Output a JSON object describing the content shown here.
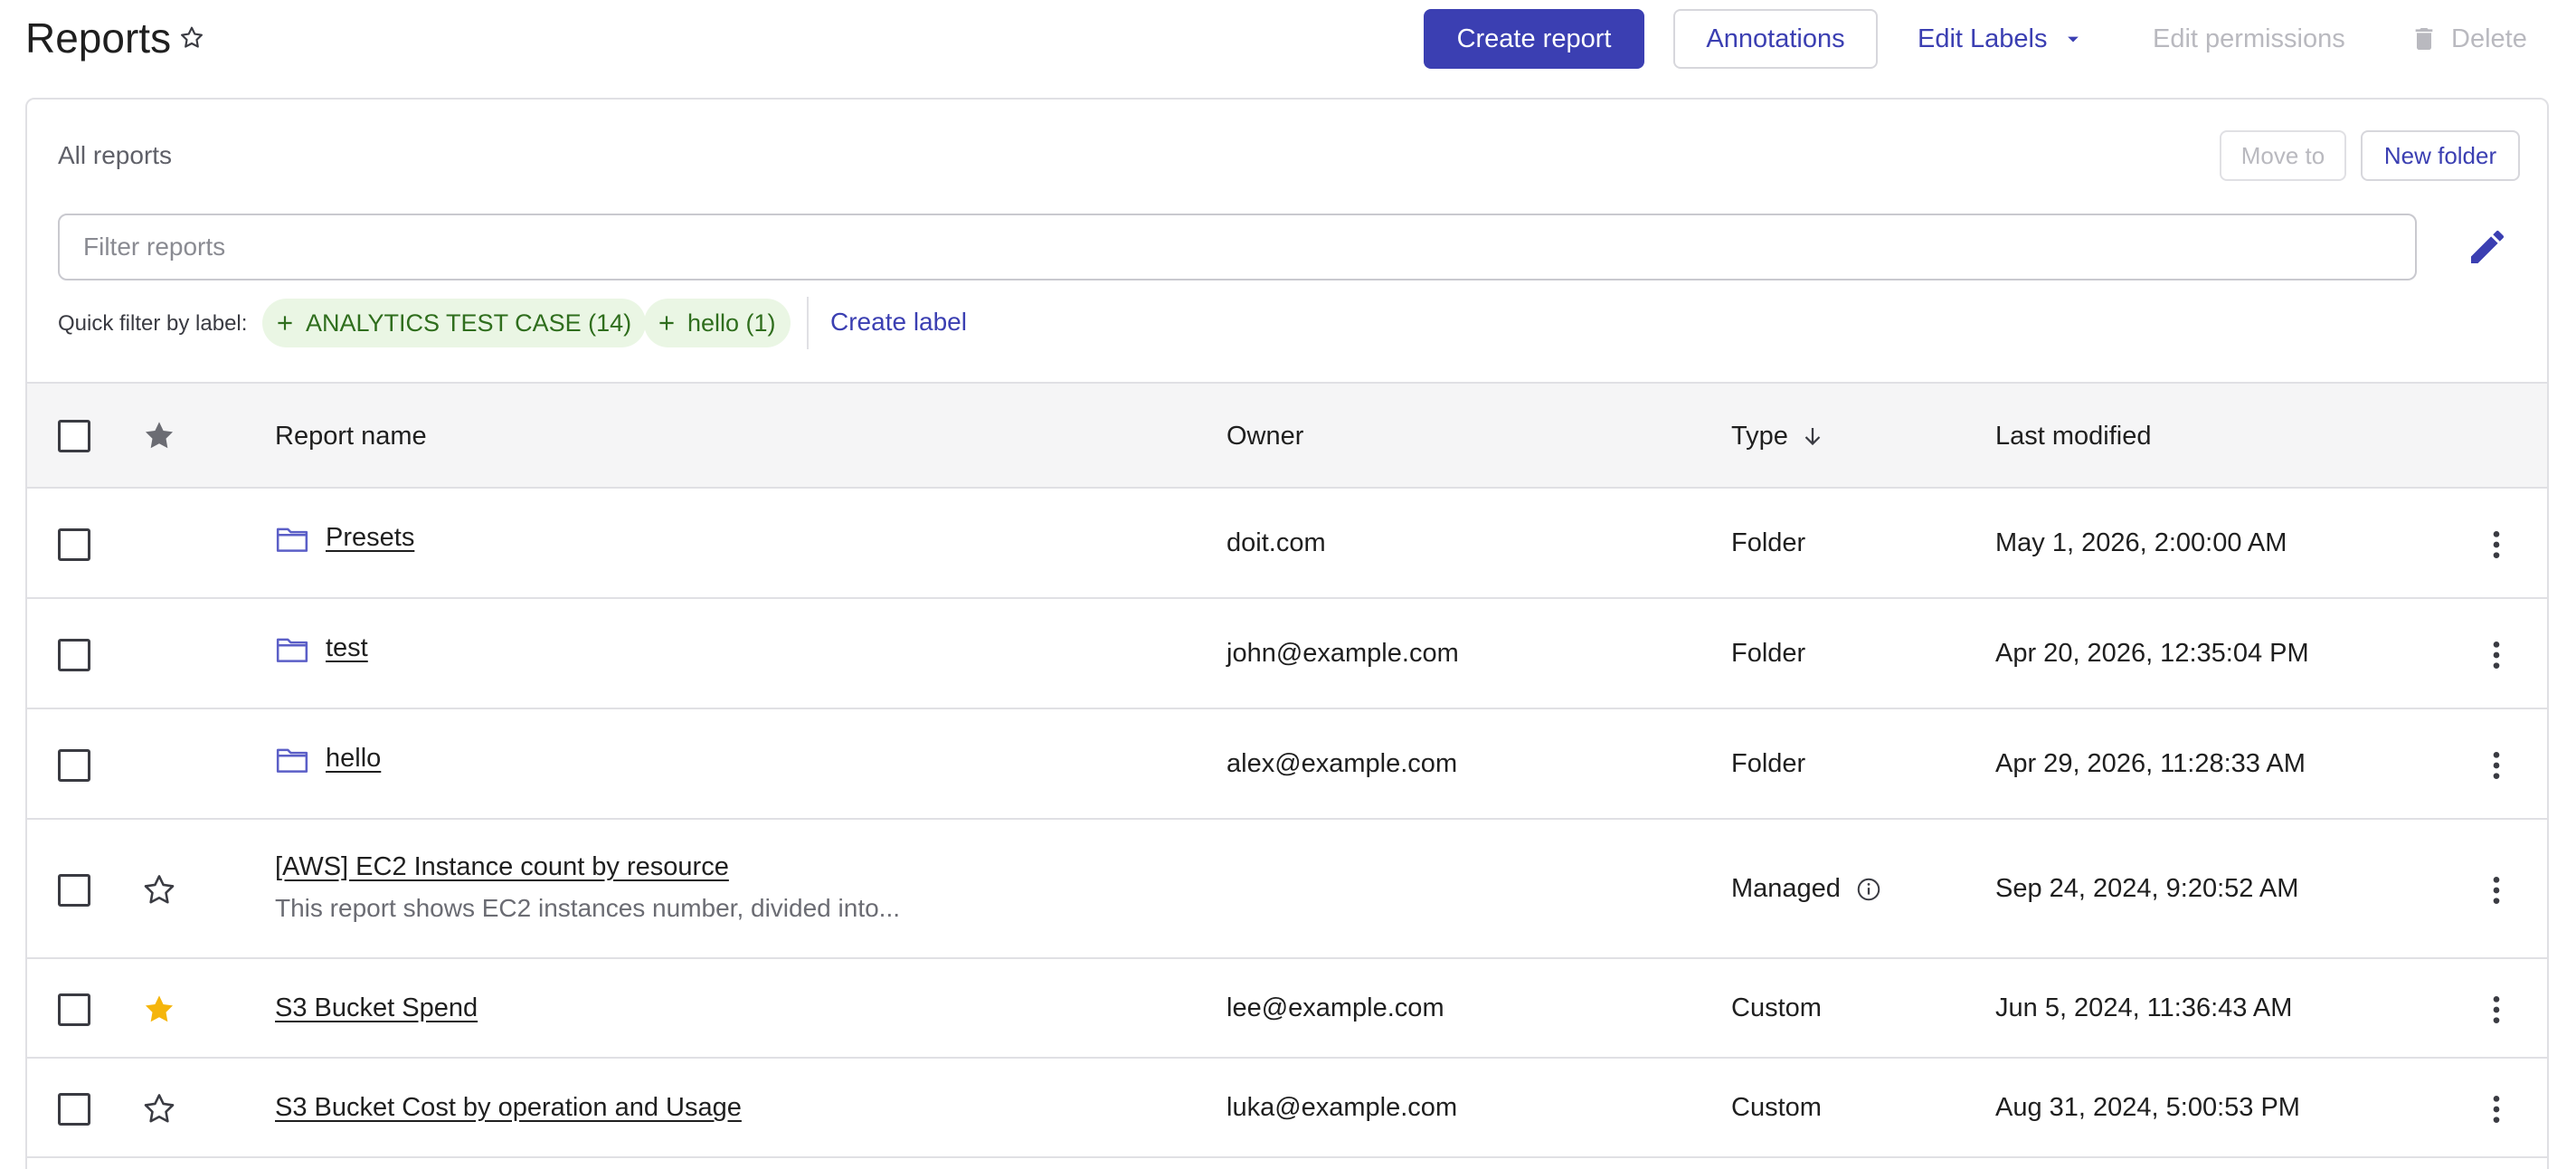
{
  "header": {
    "title": "Reports",
    "create_report": "Create report",
    "annotations": "Annotations",
    "edit_labels": "Edit Labels",
    "edit_permissions": "Edit permissions",
    "delete": "Delete"
  },
  "panel": {
    "breadcrumb": "All reports",
    "move_to": "Move to",
    "new_folder": "New folder",
    "filter_placeholder": "Filter reports",
    "quick_filter_label": "Quick filter by label:",
    "chips": [
      {
        "label": "ANALYTICS TEST CASE (14)"
      },
      {
        "label": "hello (1)"
      }
    ],
    "create_label": "Create label"
  },
  "table": {
    "columns": {
      "name": "Report name",
      "owner": "Owner",
      "type": "Type",
      "last_modified": "Last modified"
    },
    "rows": [
      {
        "name": "Presets",
        "owner": "doit.com",
        "type": "Folder",
        "modified": "May 1, 2026, 2:00:00 AM",
        "kind": "folder",
        "starred": null
      },
      {
        "name": "test",
        "owner": "john@example.com",
        "type": "Folder",
        "modified": "Apr 20, 2026, 12:35:04 PM",
        "kind": "folder",
        "starred": null
      },
      {
        "name": "hello",
        "owner": "alex@example.com",
        "type": "Folder",
        "modified": "Apr 29, 2026, 11:28:33 AM",
        "kind": "folder",
        "starred": null
      },
      {
        "name": "[AWS] EC2 Instance count by resource",
        "description": "This report shows EC2 instances number, divided into...",
        "owner": "",
        "type": "Managed",
        "modified": "Sep 24, 2024, 9:20:52 AM",
        "kind": "report",
        "starred": false
      },
      {
        "name": "S3 Bucket Spend",
        "owner": "lee@example.com",
        "type": "Custom",
        "modified": "Jun 5, 2024, 11:36:43 AM",
        "kind": "report",
        "starred": true
      },
      {
        "name": "S3 Bucket Cost by operation and Usage",
        "owner": "luka@example.com",
        "type": "Custom",
        "modified": "Aug 31, 2024, 5:00:53 PM",
        "kind": "report",
        "starred": false
      }
    ]
  },
  "colors": {
    "accent": "#3b3fb2",
    "chip_bg": "#eaf6e4",
    "chip_text": "#2f6e1d",
    "star_active": "#f5b50b",
    "folder": "#5b5fc7"
  },
  "icons": {
    "title_star": "star-outline-icon",
    "edit_labels_caret": "caret-down-icon",
    "delete": "trash-icon",
    "filter_edit": "pencil-icon",
    "chip": "plus-icon",
    "header_star": "star-filled-icon",
    "folder": "folder-icon",
    "info": "info-icon",
    "row_menu": "kebab-menu-icon",
    "sort": "arrow-down-icon"
  }
}
